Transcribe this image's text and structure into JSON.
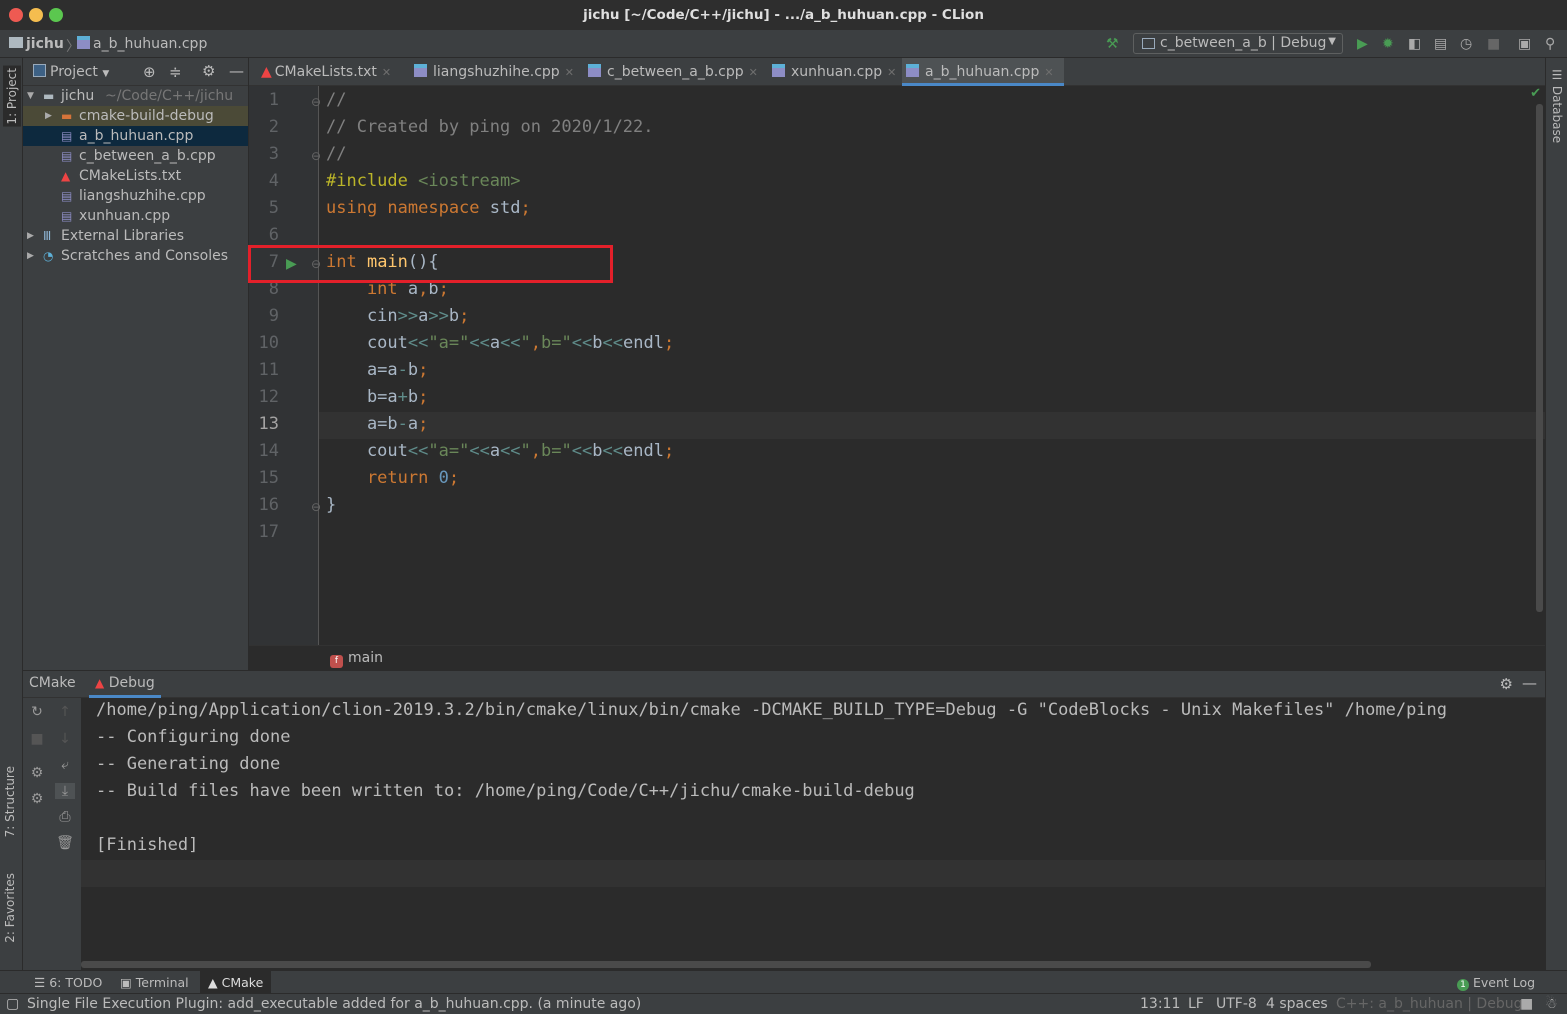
{
  "window": {
    "title": "jichu [~/Code/C++/jichu] - .../a_b_huhuan.cpp - CLion"
  },
  "navbar": {
    "project": "jichu",
    "file": "a_b_huhuan.cpp",
    "run_config": "c_between_a_b | Debug",
    "icons": [
      "hammer-icon",
      "run-icon",
      "debug-icon",
      "coverage-icon",
      "profile-icon",
      "timer-icon",
      "stop-icon",
      "terminal-layout-icon",
      "search-icon"
    ]
  },
  "left_strip": {
    "project_tab": "1: Project",
    "structure_tab": "7: Structure",
    "favorites_tab": "2: Favorites"
  },
  "right_strip": {
    "database_tab": "Database"
  },
  "project_panel": {
    "title": "Project",
    "tree": [
      {
        "label": "jichu",
        "hint": "~/Code/C++/jichu",
        "type": "folder",
        "expanded": true,
        "depth": 0
      },
      {
        "label": "cmake-build-debug",
        "type": "build-folder",
        "expanded": false,
        "depth": 1
      },
      {
        "label": "a_b_huhuan.cpp",
        "type": "cpp",
        "depth": 1,
        "selected": true
      },
      {
        "label": "c_between_a_b.cpp",
        "type": "cpp",
        "depth": 1
      },
      {
        "label": "CMakeLists.txt",
        "type": "cmake",
        "depth": 1
      },
      {
        "label": "liangshuzhihe.cpp",
        "type": "cpp",
        "depth": 1
      },
      {
        "label": "xunhuan.cpp",
        "type": "cpp",
        "depth": 1
      },
      {
        "label": "External Libraries",
        "type": "libraries",
        "expanded": false,
        "depth": 0
      },
      {
        "label": "Scratches and Consoles",
        "type": "scratches",
        "expanded": false,
        "depth": 0
      }
    ]
  },
  "tabs": [
    {
      "label": "CMakeLists.txt",
      "type": "cmake"
    },
    {
      "label": "liangshuzhihe.cpp",
      "type": "cpp"
    },
    {
      "label": "c_between_a_b.cpp",
      "type": "cpp"
    },
    {
      "label": "xunhuan.cpp",
      "type": "cpp"
    },
    {
      "label": "a_b_huhuan.cpp",
      "type": "cpp",
      "active": true
    }
  ],
  "editor": {
    "current_line": 13,
    "highlighted_line": 7,
    "lines": [
      [
        [
          "comment",
          "//"
        ]
      ],
      [
        [
          "comment",
          "// Created by ping on 2020/1/22."
        ]
      ],
      [
        [
          "comment",
          "//"
        ]
      ],
      [
        [
          "pre",
          "#include "
        ],
        [
          "inc",
          "<iostream>"
        ]
      ],
      [
        [
          "kw",
          "using namespace "
        ],
        [
          "id",
          "std"
        ],
        [
          "punc",
          ";"
        ]
      ],
      [],
      [
        [
          "kw",
          "int "
        ],
        [
          "fn",
          "main"
        ],
        [
          "id",
          "(){"
        ]
      ],
      [
        [
          "kw",
          "    int "
        ],
        [
          "id",
          "a"
        ],
        [
          "punc",
          ","
        ],
        [
          "id",
          "b"
        ],
        [
          "punc",
          ";"
        ]
      ],
      [
        [
          "id",
          "    cin"
        ],
        [
          "op",
          ">>"
        ],
        [
          "id",
          "a"
        ],
        [
          "op",
          ">>"
        ],
        [
          "id",
          "b"
        ],
        [
          "punc",
          ";"
        ]
      ],
      [
        [
          "id",
          "    cout"
        ],
        [
          "op",
          "<<"
        ],
        [
          "str",
          "\"a=\""
        ],
        [
          "op",
          "<<"
        ],
        [
          "id",
          "a"
        ],
        [
          "op",
          "<<"
        ],
        [
          "str",
          "\""
        ],
        [
          "punc",
          ","
        ],
        [
          "str",
          "b=\""
        ],
        [
          "op",
          "<<"
        ],
        [
          "id",
          "b"
        ],
        [
          "op",
          "<<"
        ],
        [
          "id",
          "endl"
        ],
        [
          "punc",
          ";"
        ]
      ],
      [
        [
          "id",
          "    a=a"
        ],
        [
          "op",
          "-"
        ],
        [
          "id",
          "b"
        ],
        [
          "punc",
          ";"
        ]
      ],
      [
        [
          "id",
          "    b=a"
        ],
        [
          "op",
          "+"
        ],
        [
          "id",
          "b"
        ],
        [
          "punc",
          ";"
        ]
      ],
      [
        [
          "id",
          "    a=b"
        ],
        [
          "op",
          "-"
        ],
        [
          "id",
          "a"
        ],
        [
          "punc",
          ";"
        ]
      ],
      [
        [
          "id",
          "    cout"
        ],
        [
          "op",
          "<<"
        ],
        [
          "str",
          "\"a=\""
        ],
        [
          "op",
          "<<"
        ],
        [
          "id",
          "a"
        ],
        [
          "op",
          "<<"
        ],
        [
          "str",
          "\""
        ],
        [
          "punc",
          ","
        ],
        [
          "str",
          "b=\""
        ],
        [
          "op",
          "<<"
        ],
        [
          "id",
          "b"
        ],
        [
          "op",
          "<<"
        ],
        [
          "id",
          "endl"
        ],
        [
          "punc",
          ";"
        ]
      ],
      [
        [
          "kw",
          "    return "
        ],
        [
          "num",
          "0"
        ],
        [
          "punc",
          ";"
        ]
      ],
      [
        [
          "id",
          "}"
        ]
      ],
      []
    ],
    "breadcrumb": "main"
  },
  "bottom_panel": {
    "tabs": [
      "CMake",
      "Debug"
    ],
    "active_tab": "Debug",
    "output": [
      "/home/ping/Application/clion-2019.3.2/bin/cmake/linux/bin/cmake -DCMAKE_BUILD_TYPE=Debug -G \"CodeBlocks - Unix Makefiles\" /home/ping",
      "-- Configuring done",
      "-- Generating done",
      "-- Build files have been written to: /home/ping/Code/C++/jichu/cmake-build-debug",
      "",
      "[Finished]"
    ]
  },
  "tool_windows": {
    "todo": "6: TODO",
    "terminal": "Terminal",
    "cmake": "CMake",
    "event_log": "Event Log",
    "event_count": "1"
  },
  "status": {
    "message": "Single File Execution Plugin: add_executable added for a_b_huhuan.cpp. (a minute ago)",
    "position": "13:11",
    "line_sep": "LF",
    "encoding": "UTF-8",
    "indent": "4 spaces",
    "context": "C++: a_b_huhuan | Debug"
  },
  "colors": {
    "accent": "#4a88c7",
    "highlight_box": "#e3202a",
    "run": "#499c54"
  }
}
